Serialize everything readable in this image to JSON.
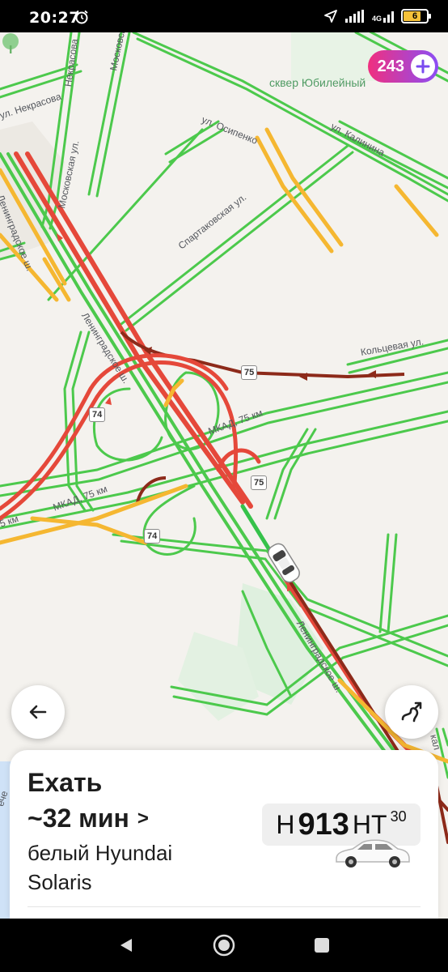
{
  "status_bar": {
    "time": "20:27",
    "network_label": "4G",
    "battery_label": "6"
  },
  "map": {
    "park_label": "сквер Юбилейный",
    "streets": [
      "ул. Некрасова",
      "Некрасова",
      "Московская ул.",
      "Московск",
      "ул. Осипенко",
      "ул. Калинина",
      "Спартаковская ул.",
      "Ленинградское ш.",
      "Ленинградское ш.",
      "Ленинградское ш.",
      "Кольцевая ул.",
      "МКАД, 75 км",
      "МКАД, 75 км",
      "5 км",
      "кал",
      "ече"
    ],
    "shields": [
      "75",
      "74",
      "75",
      "74"
    ],
    "colors": {
      "green": "#4cc94c",
      "yellow": "#f5b731",
      "red": "#e5483a",
      "dark_red": "#8d2a1a",
      "route": "#35c24a"
    }
  },
  "score_badge": {
    "value": "243",
    "icon": "plus-circle-icon"
  },
  "buttons": {
    "back_icon": "arrow-left-icon",
    "route_icon": "route-icon"
  },
  "sheet": {
    "title": "Ехать",
    "eta": "~32 мин",
    "eta_chevron": ">",
    "car_line1": "белый Hyundai",
    "car_line2": "Solaris",
    "plate": {
      "letter1": "Н",
      "digits": "913",
      "letters2": "НТ",
      "region": "30"
    },
    "car_icon": "white-sedan-icon"
  },
  "nav_bar": {
    "back_icon": "triangle-back-icon",
    "home_icon": "circle-home-icon",
    "recents_icon": "square-recents-icon"
  }
}
